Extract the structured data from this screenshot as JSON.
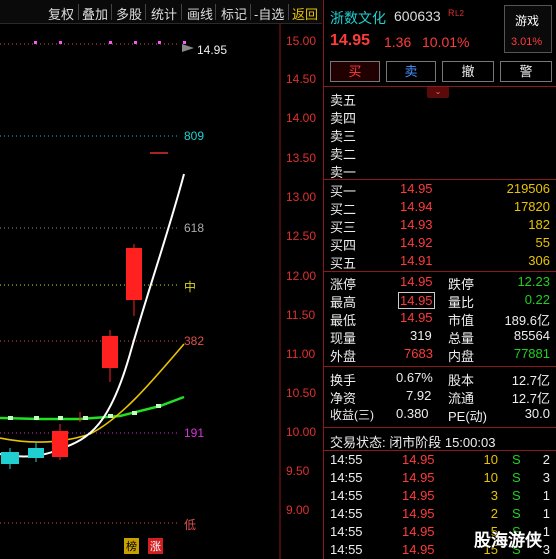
{
  "toolbar": {
    "items": [
      "复权",
      "叠加",
      "多股",
      "统计",
      "画线",
      "标记",
      "-自选"
    ],
    "back": "返回"
  },
  "chart": {
    "price_ticks": [
      "15.00",
      "14.50",
      "14.00",
      "13.50",
      "13.00",
      "12.50",
      "12.00",
      "11.50",
      "11.00",
      "10.50",
      "10.00",
      "9.50",
      "9.00"
    ],
    "top_label": "14.95",
    "fib_809": "809",
    "fib_618": "618",
    "fib_mid": "中",
    "fib_382": "382",
    "fib_191": "191",
    "fib_low": "低",
    "badges": [
      "榜",
      "涨"
    ]
  },
  "stock": {
    "name": "浙数文化",
    "code": "600633",
    "tag": "R",
    "level": "L2",
    "price": "14.95",
    "change": "1.36",
    "pct": "10.01%",
    "game_label": "游戏",
    "game_pct": "3.01%"
  },
  "actions": [
    "买",
    "卖",
    "撤",
    "警"
  ],
  "sell_levels": [
    "卖五",
    "卖四",
    "卖三",
    "卖二",
    "卖一"
  ],
  "buy_levels": [
    {
      "label": "买一",
      "price": "14.95",
      "vol": "219506"
    },
    {
      "label": "买二",
      "price": "14.94",
      "vol": "17820"
    },
    {
      "label": "买三",
      "price": "14.93",
      "vol": "182"
    },
    {
      "label": "买四",
      "price": "14.92",
      "vol": "55"
    },
    {
      "label": "买五",
      "price": "14.91",
      "vol": "306"
    }
  ],
  "stats": [
    {
      "l1": "涨停",
      "v1": "14.95",
      "l2": "跌停",
      "v2": "12.23"
    },
    {
      "l1": "最高",
      "v1": "14.95",
      "l2": "量比",
      "v2": "0.22"
    },
    {
      "l1": "最低",
      "v1": "14.95",
      "l2": "市值",
      "v2": "189.6亿"
    },
    {
      "l1": "现量",
      "v1": "319",
      "l2": "总量",
      "v2": "85564"
    },
    {
      "l1": "外盘",
      "v1": "7683",
      "l2": "内盘",
      "v2": "77881"
    }
  ],
  "fundamentals": [
    {
      "l1": "换手",
      "v1": "0.67%",
      "l2": "股本",
      "v2": "12.7亿"
    },
    {
      "l1": "净资",
      "v1": "7.92",
      "l2": "流通",
      "v2": "12.7亿"
    },
    {
      "l1": "收益(三)",
      "v1": "0.380",
      "l2": "PE(动)",
      "v2": "30.0"
    }
  ],
  "trade_status": "交易状态: 闭市阶段 15:00:03",
  "ticks": [
    {
      "time": "14:55",
      "price": "14.95",
      "vol": "10",
      "side": "S",
      "n": "2"
    },
    {
      "time": "14:55",
      "price": "14.95",
      "vol": "10",
      "side": "S",
      "n": "3"
    },
    {
      "time": "14:55",
      "price": "14.95",
      "vol": "3",
      "side": "S",
      "n": "1"
    },
    {
      "time": "14:55",
      "price": "14.95",
      "vol": "2",
      "side": "S",
      "n": "1"
    },
    {
      "time": "14:55",
      "price": "14.95",
      "vol": "5",
      "side": "S",
      "n": "1"
    },
    {
      "time": "14:55",
      "price": "14.95",
      "vol": "15",
      "side": "S",
      "n": "3"
    }
  ],
  "watermark": "股海游侠"
}
